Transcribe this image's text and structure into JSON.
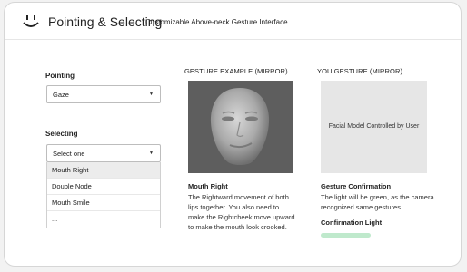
{
  "header": {
    "title": "Pointing & Selecting",
    "subtitle": "Customizable  Above-neck  Gesture Interface"
  },
  "pointing": {
    "label": "Pointing",
    "value": "Gaze"
  },
  "selecting": {
    "label": "Selecting",
    "placeholder": "Select one",
    "options": [
      "Mouth Right",
      "Double Node",
      "Mouth Smile",
      "..."
    ],
    "highlighted_option": "Mouth Right"
  },
  "example": {
    "label": "GESTURE EXAMPLE (MIRROR)",
    "title": "Mouth Right",
    "text": "The Rightward movement of both lips together. You also need to make the Rightcheek move upward to make the mouth look crooked."
  },
  "you": {
    "label": "YOU GESTURE (MIRROR)",
    "caption": "Facial Model Controlled by User",
    "title": "Gesture Confirmation",
    "text": "The light will be green, as the camera recognized same gestures.",
    "light_label": "Confirmation  Light",
    "light_color": "#bfe9cc"
  },
  "icons": {
    "logo": "smiley-logo-icon",
    "caret": "chevron-down-icon"
  },
  "colors": {
    "face_background": "#5e5e5e",
    "user_box_background": "#e6e6e6"
  }
}
